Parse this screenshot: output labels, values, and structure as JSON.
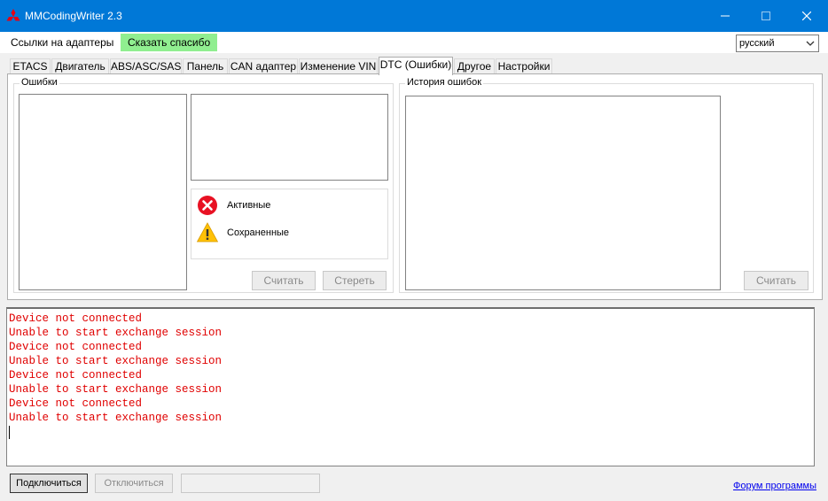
{
  "window": {
    "title": "MMCodingWriter 2.3",
    "icons": {
      "app": "mitsubishi-logo-icon",
      "minimize": "minimize-icon",
      "maximize": "maximize-icon",
      "close": "close-icon"
    }
  },
  "menu": {
    "items": [
      {
        "label": "Ссылки на адаптеры"
      },
      {
        "label": "Сказать спасибо",
        "highlight_color": "#90ee90"
      }
    ]
  },
  "language": {
    "selected": "русский",
    "icon": "chevron-down-icon"
  },
  "tabs": [
    {
      "label": "ETACS"
    },
    {
      "label": "Двигатель"
    },
    {
      "label": "ABS/ASC/SAS"
    },
    {
      "label": "Панель"
    },
    {
      "label": "CAN адаптер"
    },
    {
      "label": "Изменение VIN"
    },
    {
      "label": "DTC (Ошибки)",
      "active": true
    },
    {
      "label": "Другое"
    },
    {
      "label": "Настройки"
    }
  ],
  "dtc": {
    "errors_group": {
      "title": "Ошибки",
      "legend": {
        "active_label": "Активные",
        "saved_label": "Сохраненные",
        "active_icon": "error-circle-icon",
        "saved_icon": "warning-triangle-icon",
        "active_color": "#e81123",
        "saved_color": "#ffc107"
      },
      "read_button": "Считать",
      "erase_button": "Стереть"
    },
    "history_group": {
      "title": "История ошибок",
      "read_button": "Считать"
    }
  },
  "log": {
    "text_color": "#e00000",
    "lines": [
      "Device not connected",
      "Unable to start exchange session",
      "Device not connected",
      "Unable to start exchange session",
      "Device not connected",
      "Unable to start exchange session",
      "Device not connected",
      "Unable to start exchange session"
    ]
  },
  "footer": {
    "connect_button": "Подключиться",
    "disconnect_button": "Отключиться",
    "status_value": "",
    "forum_link": "Форум программы"
  }
}
